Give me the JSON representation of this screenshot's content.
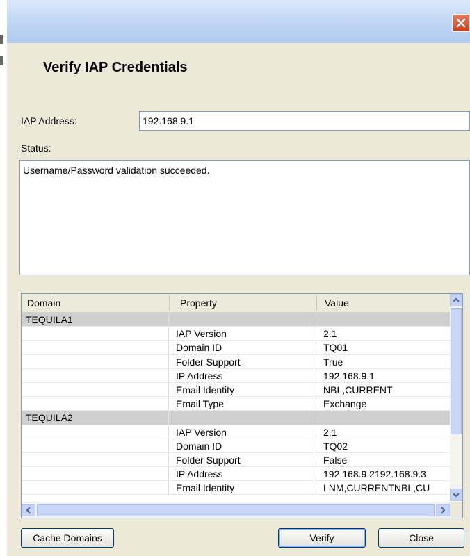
{
  "dialog": {
    "heading": "Verify IAP Credentials",
    "iap_address_label": "IAP Address:",
    "iap_address_value": "192.168.9.1",
    "status_label": "Status:",
    "status_text": "Username/Password validation succeeded."
  },
  "grid": {
    "columns": [
      "Domain",
      "Property",
      "Value"
    ],
    "rows": [
      {
        "domain": "TEQUILA1",
        "property": "",
        "value": ""
      },
      {
        "domain": "",
        "property": "IAP Version",
        "value": "2.1"
      },
      {
        "domain": "",
        "property": "Domain ID",
        "value": "TQ01"
      },
      {
        "domain": "",
        "property": "Folder Support",
        "value": "True"
      },
      {
        "domain": "",
        "property": "IP Address",
        "value": "192.168.9.1"
      },
      {
        "domain": "",
        "property": "Email Identity",
        "value": "NBL,CURRENT"
      },
      {
        "domain": "",
        "property": "Email Type",
        "value": "Exchange"
      },
      {
        "domain": "TEQUILA2",
        "property": "",
        "value": ""
      },
      {
        "domain": "",
        "property": "IAP Version",
        "value": "2.1"
      },
      {
        "domain": "",
        "property": "Domain ID",
        "value": "TQ02"
      },
      {
        "domain": "",
        "property": "Folder Support",
        "value": "False"
      },
      {
        "domain": "",
        "property": "IP Address",
        "value": "192.168.9.2192.168.9.3"
      },
      {
        "domain": "",
        "property": "Email Identity",
        "value": "LNM,CURRENTNBL,CU"
      }
    ]
  },
  "buttons": {
    "cache_domains": "Cache Domains",
    "verify": "Verify",
    "close": "Close"
  },
  "icons": {
    "close": "close-icon",
    "scroll_up": "arrow-up-icon",
    "scroll_down": "arrow-down-icon",
    "scroll_left": "arrow-left-icon",
    "scroll_right": "arrow-right-icon"
  }
}
